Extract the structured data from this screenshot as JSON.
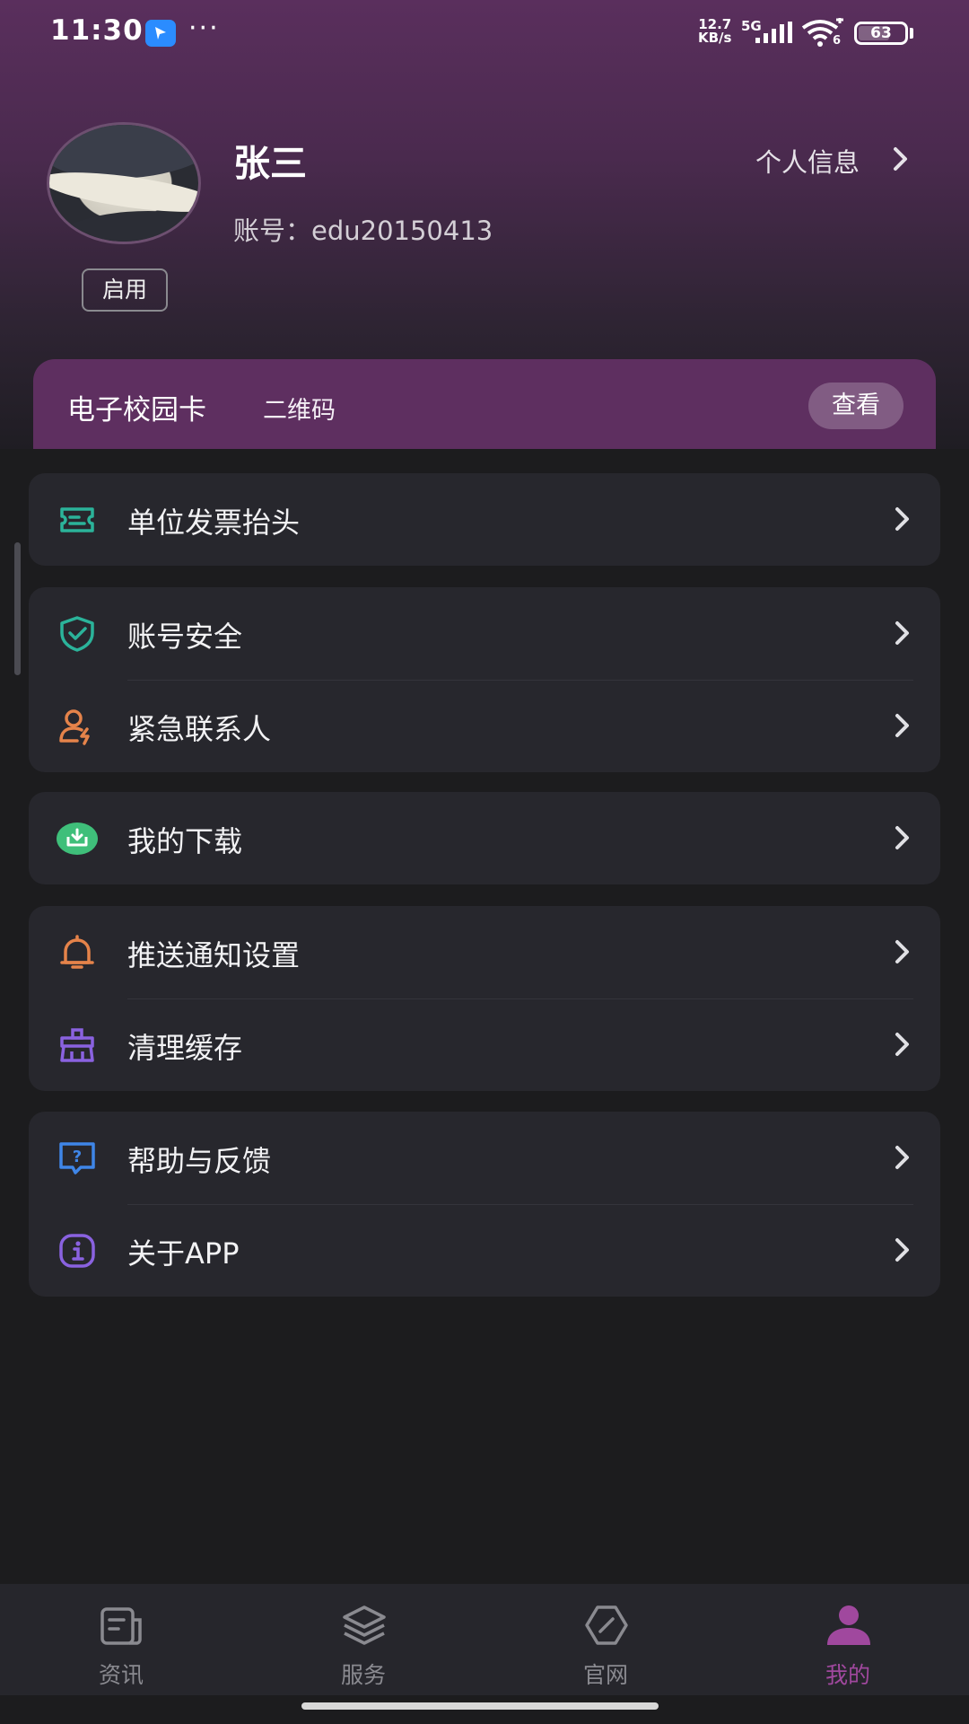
{
  "status_bar": {
    "time": "11:30",
    "more": "···",
    "net_speed_value": "12.7",
    "net_speed_unit": "KB/s",
    "network": "5G",
    "wifi_sub": "6",
    "battery": "63"
  },
  "profile": {
    "name": "张三",
    "account": "账号：edu20150413",
    "status": "启用",
    "info_link": "个人信息"
  },
  "campus_card": {
    "title": "电子校园卡",
    "subtitle": "二维码",
    "button": "查看"
  },
  "menu": {
    "invoice": "单位发票抬头",
    "security": "账号安全",
    "emergency": "紧急联系人",
    "downloads": "我的下载",
    "notifications": "推送通知设置",
    "cache": "清理缓存",
    "help": "帮助与反馈",
    "about": "关于APP"
  },
  "icons": {
    "invoice": "ticket-icon",
    "security": "shield-check-icon",
    "emergency": "user-alert-icon",
    "downloads": "download-tray-icon",
    "notifications": "bell-icon",
    "cache": "broom-icon",
    "help": "help-chat-icon",
    "about": "info-icon"
  },
  "colors": {
    "accent": "#a0489e",
    "teal": "#2bb39a",
    "orange": "#e5834a",
    "green": "#3fbf7a",
    "purple": "#8a62e0",
    "blue": "#3f86e8"
  },
  "bottom_nav": {
    "items": [
      {
        "label": "资讯"
      },
      {
        "label": "服务"
      },
      {
        "label": "官网"
      },
      {
        "label": "我的"
      }
    ],
    "active_index": 3
  }
}
